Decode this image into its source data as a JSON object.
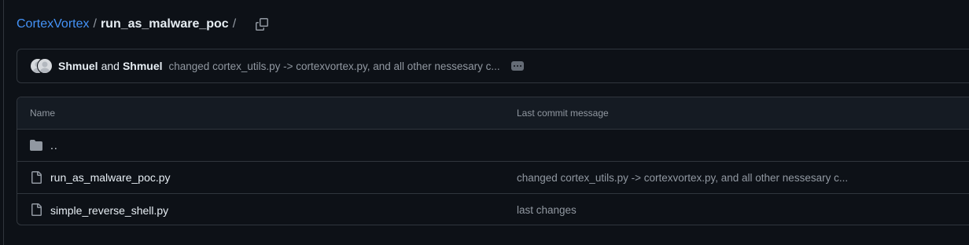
{
  "breadcrumb": {
    "owner": "CortexVortex",
    "separator": "/",
    "current": "run_as_malware_poc",
    "trailing_separator": "/"
  },
  "commit": {
    "author1": "Shmuel",
    "and": "and",
    "author2": "Shmuel",
    "message": "changed cortex_utils.py -> cortexvortex.py, and all other nessesary c..."
  },
  "table": {
    "headers": {
      "name": "Name",
      "message": "Last commit message"
    },
    "parent": "..",
    "rows": [
      {
        "name": "run_as_malware_poc.py",
        "message": "changed cortex_utils.py -> cortexvortex.py, and all other nessesary c..."
      },
      {
        "name": "simple_reverse_shell.py",
        "message": "last changes"
      }
    ]
  },
  "icons": {
    "copy": "copy-icon",
    "folder": "folder-icon",
    "file": "file-icon",
    "ellipsis": "ellipsis-icon"
  },
  "colors": {
    "background": "#0d1117",
    "link": "#4493f8",
    "border": "#30363d",
    "muted": "#9198a1"
  }
}
